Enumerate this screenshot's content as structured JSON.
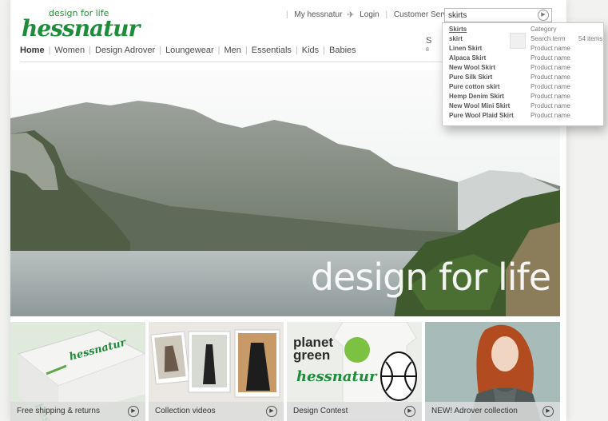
{
  "brand": {
    "tagline": "design for life",
    "wordmark": "hessnatur"
  },
  "topbar": {
    "my_account": "My hessnatur",
    "login": "Login",
    "customer_service": "Customer Service"
  },
  "search": {
    "value": "skirts"
  },
  "nav": {
    "items": [
      "Home",
      "Women",
      "Design Adrover",
      "Loungewear",
      "Men",
      "Essentials",
      "Kids",
      "Babies"
    ]
  },
  "promo_peek": {
    "line1": "S",
    "line2": "8"
  },
  "hero": {
    "headline": "design for life"
  },
  "dropdown": {
    "rows": [
      {
        "name": "Skirts",
        "type": "Category",
        "count": ""
      },
      {
        "name": "skirt",
        "type": "Search term",
        "count": "54 items"
      },
      {
        "name": "Linen Skirt",
        "type": "Product name",
        "count": ""
      },
      {
        "name": "Alpaca Skirt",
        "type": "Product name",
        "count": ""
      },
      {
        "name": "New Wool Skirt",
        "type": "Product name",
        "count": ""
      },
      {
        "name": "Pure Silk Skirt",
        "type": "Product name",
        "count": ""
      },
      {
        "name": "Pure cotton skirt",
        "type": "Product name",
        "count": ""
      },
      {
        "name": "Hemp Denim Skirt",
        "type": "Product name",
        "count": ""
      },
      {
        "name": "New Wool Mini Skirt",
        "type": "Product name",
        "count": ""
      },
      {
        "name": "Pure Wool Plaid Skirt",
        "type": "Product name",
        "count": ""
      }
    ]
  },
  "tiles": [
    {
      "caption": "Free shipping & returns"
    },
    {
      "caption": "Collection videos"
    },
    {
      "caption": "Design Contest",
      "overlay1": "planet",
      "overlay2": "green",
      "overlay3": "hessnatur"
    },
    {
      "caption": "NEW! Adrover collection"
    }
  ],
  "icons": {
    "search": "play-circle-icon",
    "tile_play": "play-circle-icon",
    "hummingbird": "hummingbird-icon"
  },
  "colors": {
    "brand_green": "#1f8c3b",
    "planet_green": "#7dc142"
  }
}
